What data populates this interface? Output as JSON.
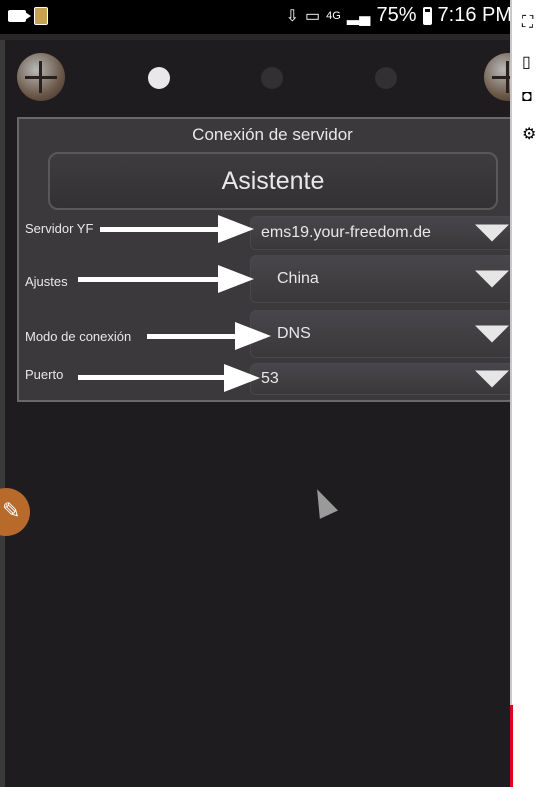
{
  "status_bar": {
    "network": "4G",
    "battery": "75%",
    "time": "7:16 PM"
  },
  "panel": {
    "title": "Conexión de servidor",
    "wizard_label": "Asistente",
    "rows": [
      {
        "label": "Servidor YF",
        "value": "ems19.your-freedom.de"
      },
      {
        "label": "Ajustes",
        "value": "China"
      },
      {
        "label": "Modo de conexión",
        "value": "DNS"
      },
      {
        "label": "Puerto",
        "value": "53"
      }
    ]
  },
  "pager": {
    "pages": 3,
    "active": 1
  },
  "icons": {
    "status_left": [
      "video-camera-icon",
      "sd-card-icon"
    ],
    "status_right": [
      "download-icon",
      "cast-icon",
      "signal-icon",
      "battery-icon"
    ],
    "strip": [
      "fullscreen-icon",
      "square-icon",
      "picture-in-picture-icon",
      "gear-icon"
    ],
    "floating": "brush-icon"
  },
  "colors": {
    "accent_orange": "#b86a2a",
    "progress_red": "#e0001a"
  }
}
